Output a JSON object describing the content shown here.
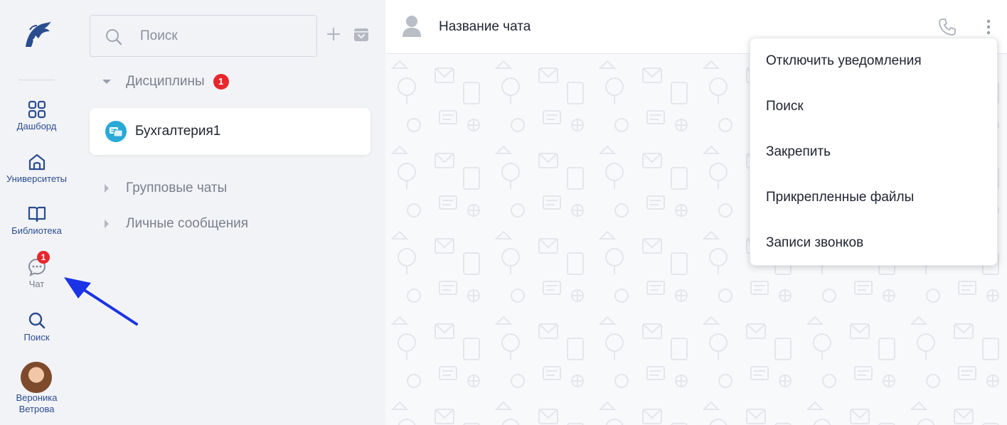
{
  "nav": {
    "items": [
      {
        "label": "Дашборд",
        "icon": "grid-icon"
      },
      {
        "label": "Университеты",
        "icon": "home-icon"
      },
      {
        "label": "Библиотека",
        "icon": "book-icon"
      },
      {
        "label": "Чат",
        "icon": "chat-icon",
        "badge": "1"
      },
      {
        "label": "Поиск",
        "icon": "search-icon"
      }
    ],
    "user": {
      "name": "Вероника Ветрова"
    }
  },
  "chat_list": {
    "search": {
      "placeholder": "Поиск"
    },
    "sections": [
      {
        "label": "Дисциплины",
        "badge": "1",
        "expanded": true
      },
      {
        "label": "Групповые чаты",
        "expanded": false
      },
      {
        "label": "Личные сообщения",
        "expanded": false
      }
    ],
    "chats": [
      {
        "name": "Бухгалтерия1"
      }
    ]
  },
  "chat": {
    "title": "Название чата"
  },
  "menu": {
    "items": [
      "Отключить уведомления",
      "Поиск",
      "Закрепить",
      "Прикрепленные файлы",
      "Записи звонков"
    ]
  },
  "colors": {
    "accent": "#2a4d8f",
    "badge": "#e8262d",
    "arrow": "#1a33e6",
    "panel": "#f2f3f7"
  }
}
